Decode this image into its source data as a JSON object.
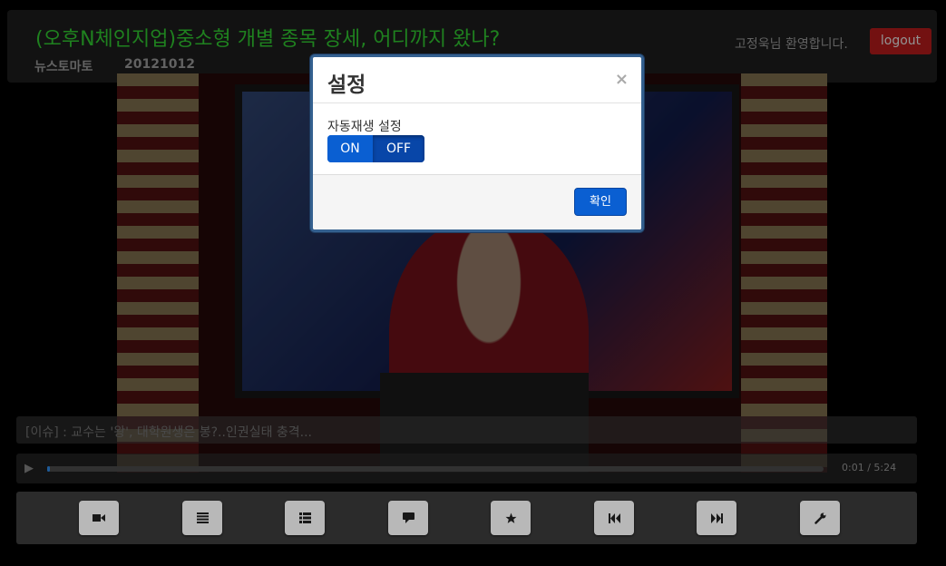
{
  "header": {
    "title": "(오후N체인지업)중소형 개별 종목 장세, 어디까지 왔나?",
    "source": "뉴스토마토",
    "date": "20121012",
    "welcome": "고정욱님 환영합니다.",
    "logout_label": "logout"
  },
  "ticker": {
    "text": "[이슈] : 교수는 '왕', 대학원생은 봉?..인권실태 충격..."
  },
  "player": {
    "time": "0:01 / 5:24",
    "progress": 0.003
  },
  "toolbar": {
    "buttons": [
      {
        "icon": "video-camera-icon"
      },
      {
        "icon": "list-lines-icon"
      },
      {
        "icon": "list-bullets-icon"
      },
      {
        "icon": "comment-icon"
      },
      {
        "icon": "star-icon"
      },
      {
        "icon": "skip-back-icon"
      },
      {
        "icon": "skip-forward-icon"
      },
      {
        "icon": "wrench-icon"
      }
    ]
  },
  "modal": {
    "title": "설정",
    "close_label": "×",
    "autoplay_label": "자동재생 설정",
    "toggle": {
      "on_label": "ON",
      "off_label": "OFF",
      "selected": "OFF"
    },
    "confirm_label": "확인"
  },
  "colors": {
    "title_green": "#2bb32b",
    "logout_red": "#a01818",
    "toggle_blue": "#0a5fd2",
    "modal_border": "#34608f"
  }
}
